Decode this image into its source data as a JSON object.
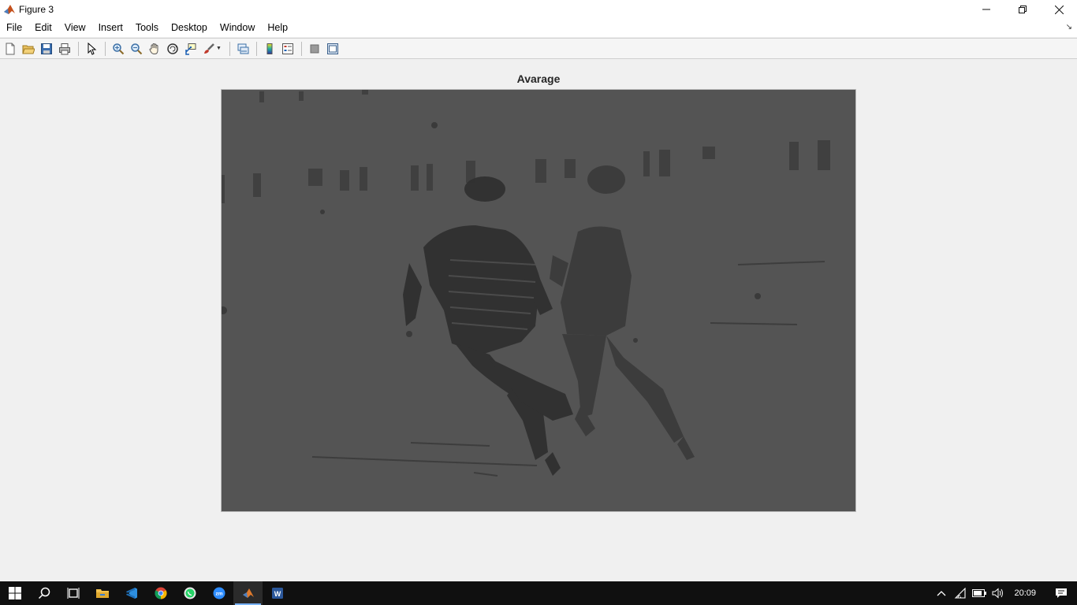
{
  "window": {
    "title": "Figure 3",
    "controls": [
      "minimize",
      "restore",
      "close"
    ]
  },
  "menu": {
    "items": [
      "File",
      "Edit",
      "View",
      "Insert",
      "Tools",
      "Desktop",
      "Window",
      "Help"
    ]
  },
  "toolbar": {
    "buttons": [
      "new-figure-icon",
      "open-icon",
      "save-icon",
      "print-icon",
      "pointer-icon",
      "zoom-in-icon",
      "zoom-out-icon",
      "pan-icon",
      "rotate-3d-icon",
      "data-cursor-icon",
      "brush-icon",
      "link-plot-icon",
      "colorbar-icon",
      "legend-icon",
      "hide-plot-tools-icon",
      "show-plot-tools-icon"
    ]
  },
  "axes": {
    "title": "Avarage",
    "image_description_colors": {
      "background": "#545454"
    }
  },
  "taskbar": {
    "apps": [
      "windows-start-icon",
      "search-icon",
      "task-view-icon",
      "file-explorer-icon",
      "vscode-icon",
      "chrome-icon",
      "whatsapp-icon",
      "zoom-icon",
      "matlab-icon",
      "word-icon"
    ],
    "active_app": "matlab-icon",
    "clock": "20:09"
  }
}
